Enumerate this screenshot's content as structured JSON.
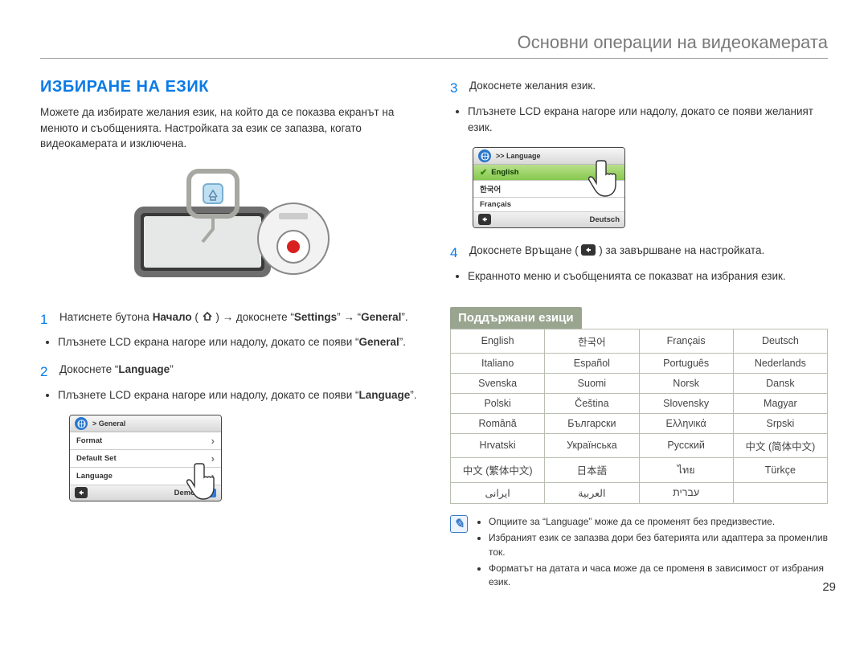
{
  "chapterTitle": "Основни операции на видеокамерата",
  "sectionTitle": "ИЗБИРАНЕ НА ЕЗИК",
  "intro": "Можете да избирате желания език, на който да се показва екранът на менюто и съобщенията. Настройката за език се запазва, когато видеокамерата и изключена.",
  "steps": {
    "s1_pre": "Натиснете бутона ",
    "s1_home": "Начало",
    "s1_mid": " ( ",
    "s1_after_icon": " ) → докоснете “",
    "s1_settings": "Settings",
    "s1_arrow": "” → “",
    "s1_general": "General",
    "s1_end": "”.",
    "s1_bullet_a": "Плъзнете LCD екрана нагоре или надолу, докато се появи “",
    "s1_bullet_b": "”.",
    "s2_text_a": "Докоснете “",
    "s2_lang": "Language",
    "s2_text_b": "”",
    "s2_bullet_a": "Плъзнете LCD екрана нагоре или надолу, докато се появи “",
    "s2_bullet_b": "”.",
    "s3_text": "Докоснете желания език.",
    "s3_bullet": "Плъзнете LCD екрана нагоре или надолу, докато се появи желаният език.",
    "s4_text_a": "Докоснете Връщане ( ",
    "s4_text_b": " ) за завършване на настройката.",
    "s4_bullet": "Екранното меню и съобщенията се показват на избрания език."
  },
  "screen1": {
    "header": "> General",
    "rows": [
      "Format",
      "Default Set",
      "Language",
      "Demo"
    ],
    "demoOn": "ON"
  },
  "screen2": {
    "header": ">> Language",
    "rows": [
      "English",
      "한국어",
      "Français",
      "Deutsch"
    ]
  },
  "subheading": "Поддържани езици",
  "languages": [
    [
      "English",
      "한국어",
      "Français",
      "Deutsch"
    ],
    [
      "Italiano",
      "Español",
      "Português",
      "Nederlands"
    ],
    [
      "Svenska",
      "Suomi",
      "Norsk",
      "Dansk"
    ],
    [
      "Polski",
      "Čeština",
      "Slovensky",
      "Magyar"
    ],
    [
      "Română",
      "Български",
      "Ελληνικά",
      "Srpski"
    ],
    [
      "Hrvatski",
      "Українська",
      "Русский",
      "中文 (简体中文)"
    ],
    [
      "中文 (繁体中文)",
      "日本語",
      "ไทย",
      "Türkçe"
    ],
    [
      "ایرانی",
      "العربیة",
      "עברית",
      ""
    ]
  ],
  "notes": [
    "Опциите за “Language” може да се променят без предизвестие.",
    "Избраният език се запазва дори без батерията или адаптера за променлив ток.",
    "Форматът на датата и часа може да се променя в зависимост от избрания език."
  ],
  "pageNumber": "29",
  "noteIconGlyph": "✎"
}
